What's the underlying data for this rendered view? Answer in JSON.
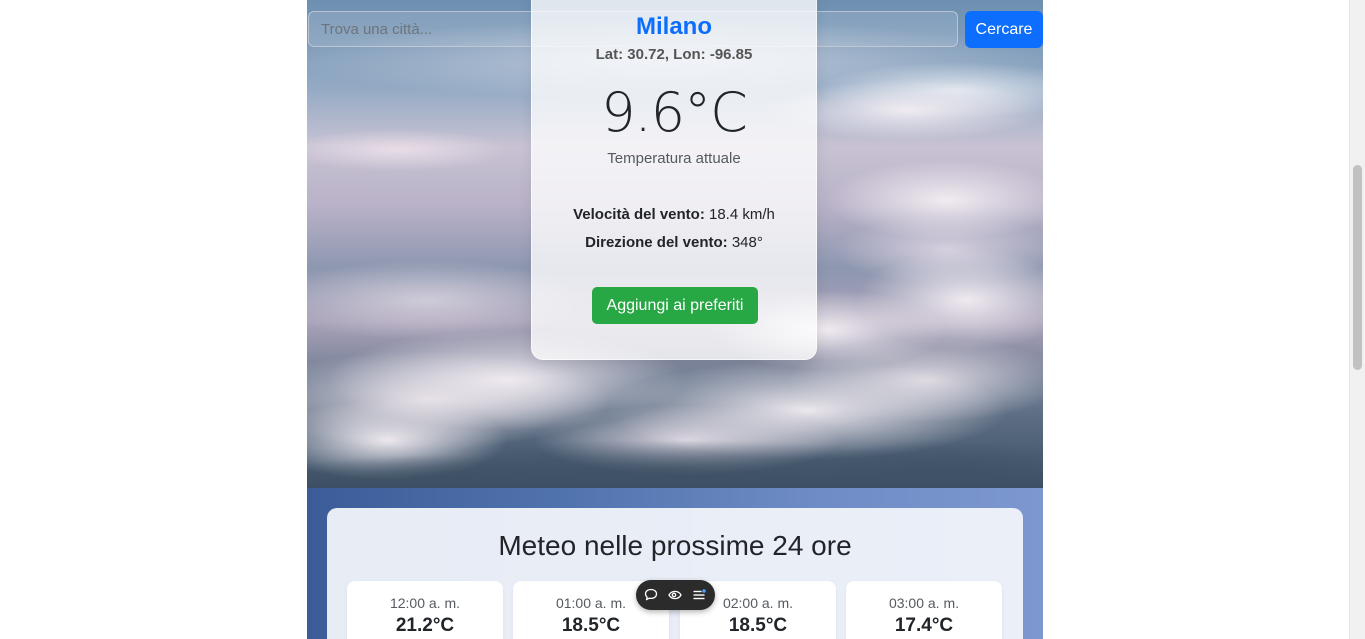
{
  "search": {
    "placeholder": "Trova una città...",
    "value": "",
    "button_label": "Cercare"
  },
  "current": {
    "city": "Milano",
    "coords": "Lat: 30.72, Lon: -96.85",
    "temperature": "9.6°C",
    "temperature_caption": "Temperatura attuale",
    "wind_speed_label": "Velocità del vento:",
    "wind_speed_value": " 18.4 km/h",
    "wind_direction_label": "Direzione del vento:",
    "wind_direction_value": " 348°",
    "favorite_button_label": "Aggiungi ai preferiti"
  },
  "forecast": {
    "title": "Meteo nelle prossime 24 ore",
    "hours": [
      {
        "time": "12:00 a. m.",
        "temp": "21.2°C"
      },
      {
        "time": "01:00 a. m.",
        "temp": "18.5°C"
      },
      {
        "time": "02:00 a. m.",
        "temp": "18.5°C"
      },
      {
        "time": "03:00 a. m.",
        "temp": "17.4°C"
      }
    ]
  },
  "toolbar": {
    "icons": [
      "comment-icon",
      "eye-icon",
      "list-icon"
    ]
  },
  "colors": {
    "primary": "#0d6efd",
    "success": "#28a745"
  }
}
